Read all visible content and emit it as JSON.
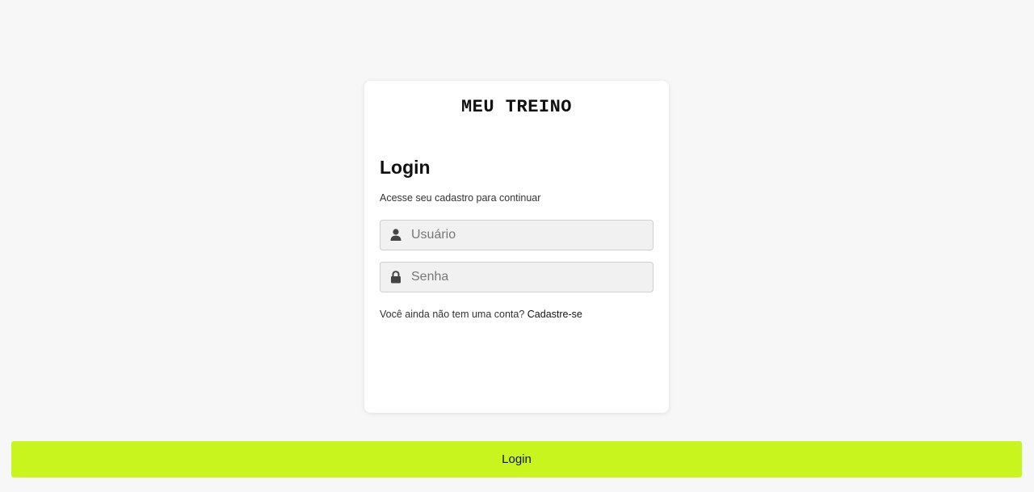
{
  "brand": {
    "title": "MEU TREINO"
  },
  "login": {
    "title": "Login",
    "subtitle": "Acesse seu cadastro para continuar",
    "username": {
      "placeholder": "Usuário",
      "value": "",
      "icon": "user-icon"
    },
    "password": {
      "placeholder": "Senha",
      "value": "",
      "icon": "lock-icon"
    },
    "signup_prompt": "Você ainda não tem uma conta?",
    "signup_link": "Cadastre-se",
    "submit_label": "Login"
  },
  "colors": {
    "background": "#f7f7f7",
    "card": "#ffffff",
    "accent": "#c8f51e",
    "field_bg": "#f1f1f1",
    "icon": "#444444"
  }
}
